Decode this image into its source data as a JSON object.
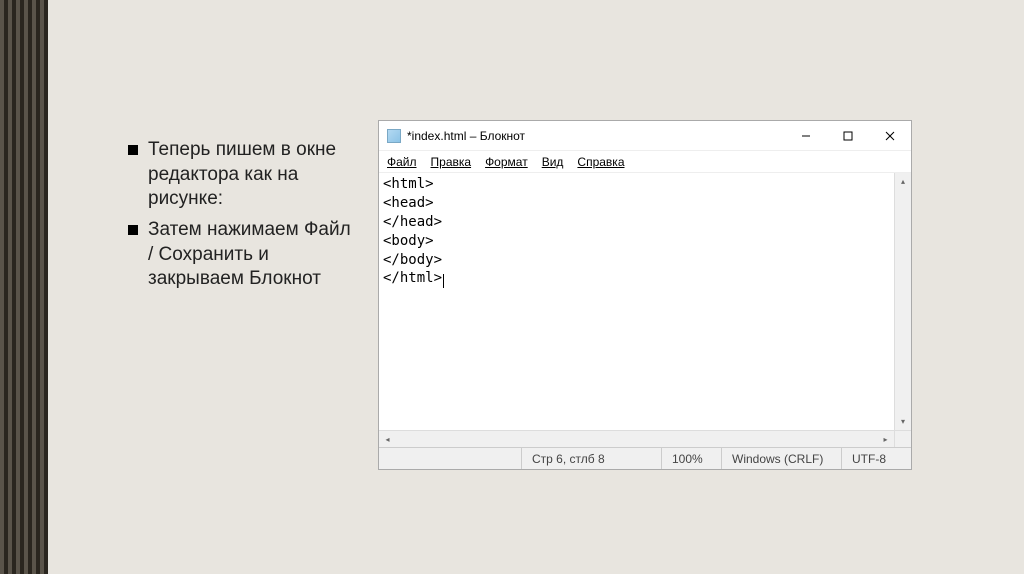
{
  "slide": {
    "bullets": [
      "Теперь пишем в окне редактора как на рисунке:",
      "Затем нажимаем Файл / Сохранить и закрываем Блокнот"
    ]
  },
  "notepad": {
    "title": "*index.html – Блокнот",
    "menu": {
      "file": "Файл",
      "edit": "Правка",
      "format": "Формат",
      "view": "Вид",
      "help": "Справка"
    },
    "content_lines": [
      "<html>",
      "<head>",
      "</head>",
      "<body>",
      "</body>",
      "</html>"
    ],
    "status": {
      "position": "Стр 6, стлб 8",
      "zoom": "100%",
      "lineending": "Windows (CRLF)",
      "encoding": "UTF-8"
    }
  }
}
